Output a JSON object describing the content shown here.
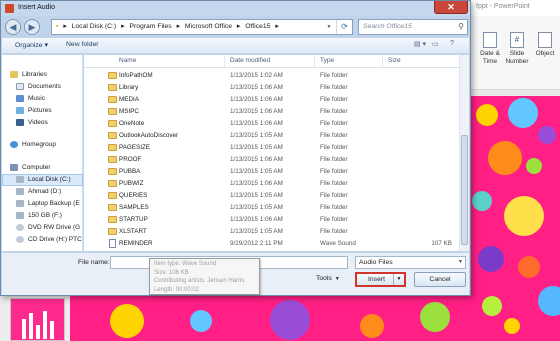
{
  "background_app": {
    "title": "fppt - PowerPoint",
    "ribbon_items": [
      {
        "label": "Date &\nTime",
        "icon": "calendar-icon"
      },
      {
        "label": "Slide\nNumber",
        "icon": "hash-icon"
      },
      {
        "label": "Object",
        "icon": "object-icon"
      }
    ]
  },
  "dialog": {
    "title": "Insert Audio",
    "close_glyph": "✕",
    "nav": {
      "back_glyph": "◀",
      "forward_glyph": "▶"
    },
    "address": {
      "parts": [
        "Local Disk (C:)",
        "Program Files",
        "Microsoft Office",
        "Office15"
      ],
      "separator": "▸"
    },
    "search": {
      "placeholder": "Search Office15"
    },
    "toolbar": {
      "organize": "Organize ▾",
      "new_folder": "New folder"
    },
    "sidebar": [
      {
        "label": "Libraries",
        "icon": "libraries-icon",
        "level": 0,
        "selected": false
      },
      {
        "label": "Documents",
        "icon": "documents-icon",
        "level": 1,
        "selected": false
      },
      {
        "label": "Music",
        "icon": "music-icon",
        "level": 1,
        "selected": false
      },
      {
        "label": "Pictures",
        "icon": "pictures-icon",
        "level": 1,
        "selected": false
      },
      {
        "label": "Videos",
        "icon": "videos-icon",
        "level": 1,
        "selected": false
      },
      {
        "label": "Homegroup",
        "icon": "homegroup-icon",
        "level": 0,
        "selected": false
      },
      {
        "label": "Computer",
        "icon": "computer-icon",
        "level": 0,
        "selected": false
      },
      {
        "label": "Local Disk (C:)",
        "icon": "drive-icon",
        "level": 1,
        "selected": true
      },
      {
        "label": "Ahmad (D:)",
        "icon": "drive-icon",
        "level": 1,
        "selected": false
      },
      {
        "label": "Laptop Backup (E",
        "icon": "drive-icon",
        "level": 1,
        "selected": false
      },
      {
        "label": "150 GB (F:)",
        "icon": "drive-icon",
        "level": 1,
        "selected": false
      },
      {
        "label": "DVD RW Drive (G",
        "icon": "dvd-icon",
        "level": 1,
        "selected": false
      },
      {
        "label": "CD Drive (H:) PTC",
        "icon": "cd-icon",
        "level": 1,
        "selected": false
      }
    ],
    "columns": {
      "name": "Name",
      "date": "Date modified",
      "type": "Type",
      "size": "Size"
    },
    "files": [
      {
        "name": "InfoPathOM",
        "date": "1/13/2015 1:02 AM",
        "type": "File folder",
        "size": "",
        "kind": "folder"
      },
      {
        "name": "Library",
        "date": "1/13/2015 1:06 AM",
        "type": "File folder",
        "size": "",
        "kind": "folder"
      },
      {
        "name": "MEDIA",
        "date": "1/13/2015 1:06 AM",
        "type": "File folder",
        "size": "",
        "kind": "folder"
      },
      {
        "name": "MSIPC",
        "date": "1/13/2015 1:06 AM",
        "type": "File folder",
        "size": "",
        "kind": "folder"
      },
      {
        "name": "OneNote",
        "date": "1/13/2015 1:06 AM",
        "type": "File folder",
        "size": "",
        "kind": "folder"
      },
      {
        "name": "OutlookAutoDiscover",
        "date": "1/13/2015 1:05 AM",
        "type": "File folder",
        "size": "",
        "kind": "folder"
      },
      {
        "name": "PAGESIZE",
        "date": "1/13/2015 1:05 AM",
        "type": "File folder",
        "size": "",
        "kind": "folder"
      },
      {
        "name": "PROOF",
        "date": "1/13/2015 1:06 AM",
        "type": "File folder",
        "size": "",
        "kind": "folder"
      },
      {
        "name": "PUBBA",
        "date": "1/13/2015 1:05 AM",
        "type": "File folder",
        "size": "",
        "kind": "folder"
      },
      {
        "name": "PUBWIZ",
        "date": "1/13/2015 1:06 AM",
        "type": "File folder",
        "size": "",
        "kind": "folder"
      },
      {
        "name": "QUERIES",
        "date": "1/13/2015 1:05 AM",
        "type": "File folder",
        "size": "",
        "kind": "folder"
      },
      {
        "name": "SAMPLES",
        "date": "1/13/2015 1:05 AM",
        "type": "File folder",
        "size": "",
        "kind": "folder"
      },
      {
        "name": "STARTUP",
        "date": "1/13/2015 1:06 AM",
        "type": "File folder",
        "size": "",
        "kind": "folder"
      },
      {
        "name": "XLSTART",
        "date": "1/13/2015 1:05 AM",
        "type": "File folder",
        "size": "",
        "kind": "folder"
      },
      {
        "name": "REMINDER",
        "date": "9/29/2012 2:11 PM",
        "type": "Wave Sound",
        "size": "107 KB",
        "kind": "wav"
      }
    ],
    "file_name_label": "File name:",
    "file_name_value": "",
    "filter": {
      "selected": "Audio Files"
    },
    "tools_label": "Tools",
    "insert_label": "Insert",
    "cancel_label": "Cancel",
    "tooltip": {
      "lines": [
        "Item type: Wave Sound",
        "Size: 106 KB",
        "Contributing artists: Jensen Harris",
        "Length: 00:00:02"
      ]
    }
  }
}
